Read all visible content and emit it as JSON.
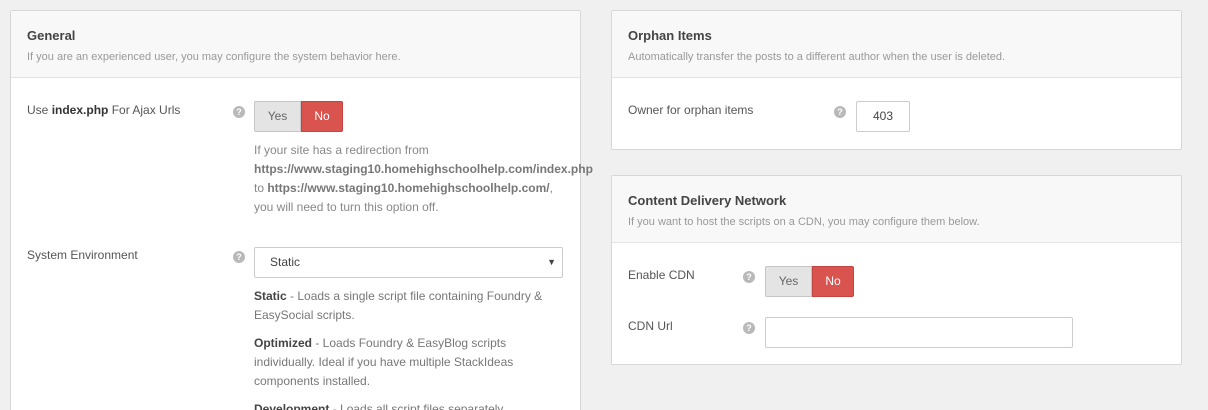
{
  "general": {
    "title": "General",
    "description": "If you are an experienced user, you may configure the system behavior here.",
    "ajax": {
      "label_prefix": "Use ",
      "label_bold": "index.php",
      "label_suffix": " For Ajax Urls",
      "yes": "Yes",
      "no": "No",
      "note_line1": "If your site has a redirection from",
      "note_url1": "https://www.staging10.homehighschoolhelp.com/index.php",
      "note_to": "to ",
      "note_url2": "https://www.staging10.homehighschoolhelp.com/",
      "note_comma": ",",
      "note_line4": "you will need to turn this option off."
    },
    "environment": {
      "label": "System Environment",
      "selected": "Static",
      "static_name": "Static",
      "static_desc_a": " - Loads a single script file containing Foundry &",
      "static_desc_b": "EasySocial scripts.",
      "optimized_name": "Optimized",
      "optimized_desc_a": " - Loads Foundry & EasyBlog scripts",
      "optimized_desc_b": "individually. Ideal if you have multiple StackIdeas",
      "optimized_desc_c": "components installed.",
      "development_name": "Development",
      "development_desc_a": " - Loads all script files separately."
    }
  },
  "orphan": {
    "title": "Orphan Items",
    "description": "Automatically transfer the posts to a different author when the user is deleted.",
    "owner_label": "Owner for orphan items",
    "owner_value": "403"
  },
  "cdn": {
    "title": "Content Delivery Network",
    "description": "If you want to host the scripts on a CDN, you may configure them below.",
    "enable_label": "Enable CDN",
    "yes": "Yes",
    "no": "No",
    "url_label": "CDN Url",
    "url_value": ""
  },
  "icons": {
    "help": "help-icon",
    "dropdown": "chevron-down-icon"
  },
  "colors": {
    "accent_no": "#d9534f",
    "toggle_off": "#e4e4e4"
  }
}
